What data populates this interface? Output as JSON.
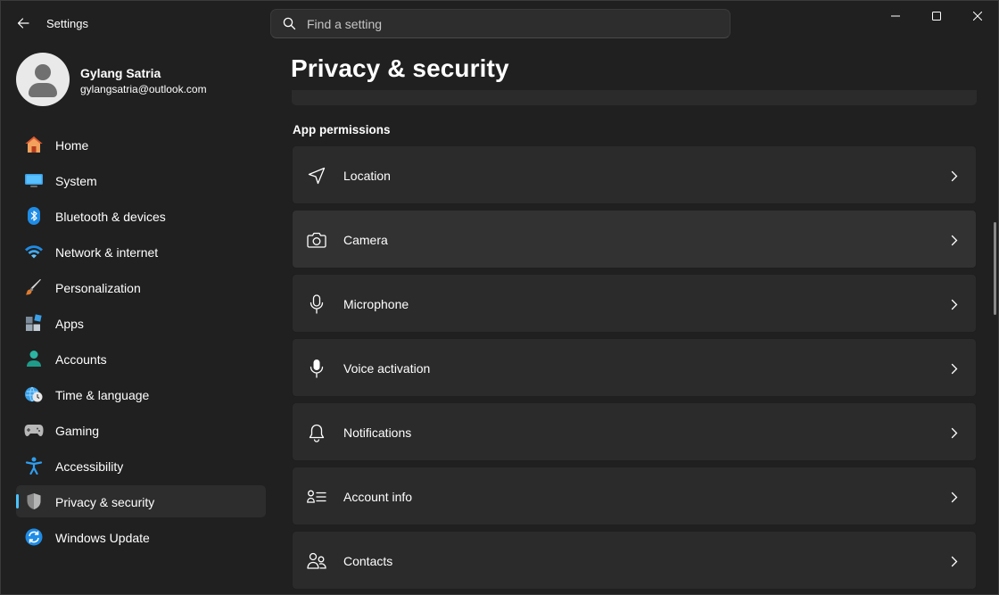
{
  "app": {
    "title": "Settings"
  },
  "search": {
    "placeholder": "Find a setting"
  },
  "profile": {
    "name": "Gylang Satria",
    "email": "gylangsatria@outlook.com"
  },
  "sidebar": {
    "items": [
      {
        "label": "Home",
        "icon": "home-icon"
      },
      {
        "label": "System",
        "icon": "system-monitor-icon"
      },
      {
        "label": "Bluetooth & devices",
        "icon": "bluetooth-icon"
      },
      {
        "label": "Network & internet",
        "icon": "wifi-icon"
      },
      {
        "label": "Personalization",
        "icon": "paintbrush-icon"
      },
      {
        "label": "Apps",
        "icon": "apps-icon"
      },
      {
        "label": "Accounts",
        "icon": "person-icon"
      },
      {
        "label": "Time & language",
        "icon": "clock-globe-icon"
      },
      {
        "label": "Gaming",
        "icon": "gamepad-icon"
      },
      {
        "label": "Accessibility",
        "icon": "accessibility-icon"
      },
      {
        "label": "Privacy & security",
        "icon": "shield-icon",
        "selected": true
      },
      {
        "label": "Windows Update",
        "icon": "update-icon"
      }
    ]
  },
  "main": {
    "page_title": "Privacy & security",
    "section_title": "App permissions",
    "cards": [
      {
        "label": "Location",
        "icon": "location-arrow-icon"
      },
      {
        "label": "Camera",
        "icon": "camera-icon"
      },
      {
        "label": "Microphone",
        "icon": "microphone-icon"
      },
      {
        "label": "Voice activation",
        "icon": "voice-microphone-icon"
      },
      {
        "label": "Notifications",
        "icon": "bell-icon"
      },
      {
        "label": "Account info",
        "icon": "account-info-icon"
      },
      {
        "label": "Contacts",
        "icon": "contacts-icon"
      }
    ]
  },
  "colors": {
    "accent": "#4cc2ff",
    "background": "#202020",
    "card": "#2b2b2b"
  }
}
